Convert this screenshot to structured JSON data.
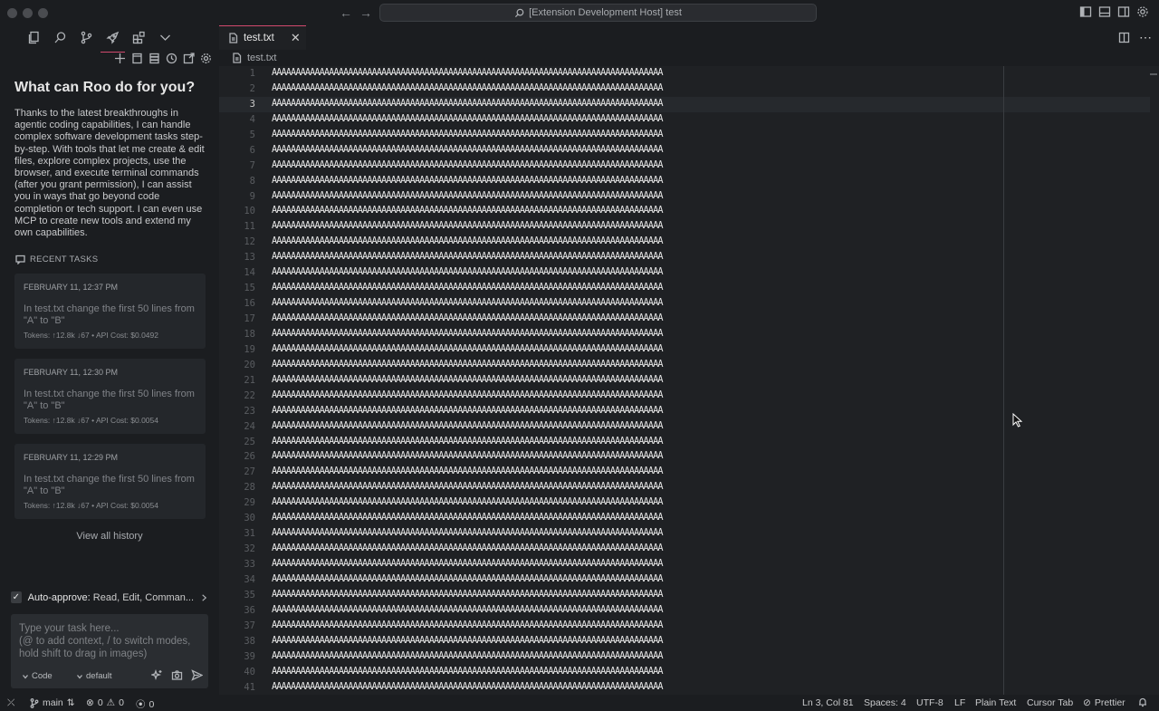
{
  "window": {
    "command_center": "[Extension Development Host] test"
  },
  "sidebar": {
    "activity_items": [
      "explorer-icon",
      "search-icon",
      "source-control-icon",
      "roo-rocket-icon",
      "extensions-icon",
      "chevron-down-icon"
    ],
    "welcome_title": "What can Roo do for you?",
    "welcome_text": "Thanks to the latest breakthroughs in agentic coding capabilities, I can handle complex software development tasks step-by-step. With tools that let me create & edit files, explore complex projects, use the browser, and execute terminal commands (after you grant permission), I can assist you in ways that go beyond code completion or tech support. I can even use MCP to create new tools and extend my own capabilities.",
    "recent_tasks_label": "RECENT TASKS",
    "tasks": [
      {
        "date": "FEBRUARY 11, 12:37 PM",
        "text": "In test.txt change the first 50 lines from \"A\" to \"B\"",
        "meta": "Tokens: ↑12.8k ↓67 • API Cost: $0.0492"
      },
      {
        "date": "FEBRUARY 11, 12:30 PM",
        "text": "In test.txt change the first 50 lines from \"A\" to \"B\"",
        "meta": "Tokens: ↑12.8k ↓67 • API Cost: $0.0054"
      },
      {
        "date": "FEBRUARY 11, 12:29 PM",
        "text": "In test.txt change the first 50 lines from \"A\" to \"B\"",
        "meta": "Tokens: ↑12.8k ↓67 • API Cost: $0.0054"
      }
    ],
    "view_all_history": "View all history",
    "auto_approve_label": "Auto-approve:",
    "auto_approve_value": "Read, Edit, Comman...",
    "input_placeholder": "Type your task here...\n(@ to add context, / to switch modes, hold shift to drag in images)",
    "mode": "Code",
    "config": "default"
  },
  "editor": {
    "tab_label": "test.txt",
    "breadcrumb": "test.txt",
    "current_line": 3,
    "line_content": "AAAAAAAAAAAAAAAAAAAAAAAAAAAAAAAAAAAAAAAAAAAAAAAAAAAAAAAAAAAAAAAAAAAAAAAAAAAAAAAAAA",
    "visible_line_count": 41
  },
  "statusbar": {
    "branch": "main",
    "errors": "0",
    "warnings": "0",
    "ports": "0",
    "position": "Ln 3, Col 81",
    "spaces": "Spaces: 4",
    "encoding": "UTF-8",
    "eol": "LF",
    "language": "Plain Text",
    "cursor_tab": "Cursor Tab",
    "prettier": "Prettier"
  }
}
